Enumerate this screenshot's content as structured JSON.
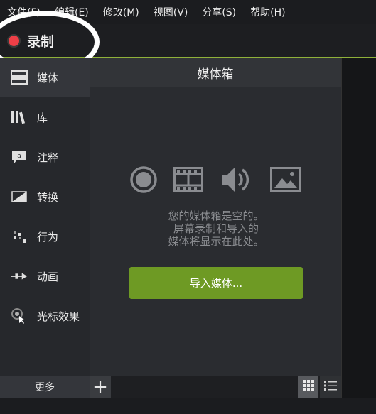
{
  "menu": [
    "文件(F)",
    "编辑(E)",
    "修改(M)",
    "视图(V)",
    "分享(S)",
    "帮助(H)"
  ],
  "toolbar": {
    "record_label": "录制"
  },
  "sidebar": {
    "items": [
      {
        "label": "媒体",
        "icon": "film-icon"
      },
      {
        "label": "库",
        "icon": "library-books-icon"
      },
      {
        "label": "注释",
        "icon": "annotation-callout-icon"
      },
      {
        "label": "转换",
        "icon": "transition-icon"
      },
      {
        "label": "行为",
        "icon": "behavior-icon"
      },
      {
        "label": "动画",
        "icon": "animation-arrow-icon"
      },
      {
        "label": "光标效果",
        "icon": "cursor-effect-icon"
      }
    ],
    "more_label": "更多"
  },
  "main": {
    "title": "媒体箱",
    "empty_lines": [
      "您的媒体箱是空的。",
      "屏幕录制和导入的",
      "媒体将显示在此处。"
    ],
    "import_label": "导入媒体...",
    "media_type_icons": [
      "record-icon",
      "film-icon",
      "audio-icon",
      "image-icon"
    ]
  },
  "bottom": {
    "add_label": "+"
  },
  "colors": {
    "accent_green": "#6e9a24",
    "record_red": "#ef3f47",
    "toolbar_border": "#8fb13a"
  }
}
